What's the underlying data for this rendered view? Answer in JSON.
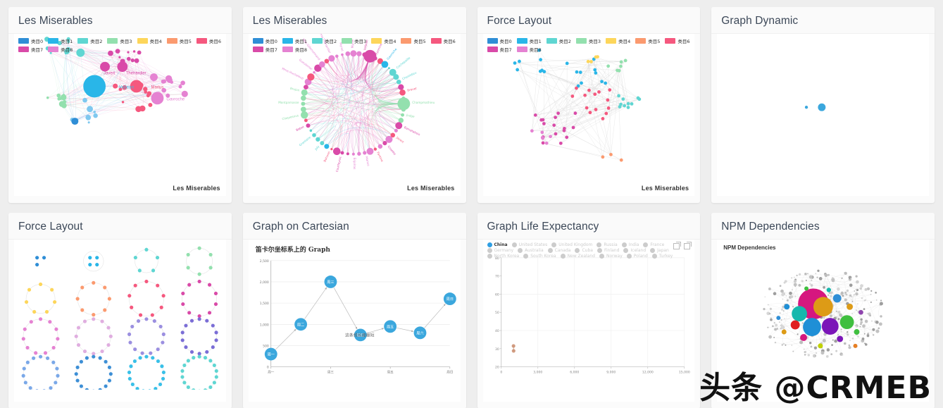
{
  "page": {
    "background": "#eeeeee",
    "watermark": "头条 @CRMEB"
  },
  "cards": [
    {
      "title": "Les Miserables",
      "subtitle": "",
      "footer": "Les Miserables"
    },
    {
      "title": "Les Miserables",
      "subtitle": "",
      "footer": "Les Miserables"
    },
    {
      "title": "Force Layout",
      "subtitle": "",
      "footer": "Les Miserables"
    },
    {
      "title": "Graph Dynamic",
      "subtitle": "",
      "footer": ""
    },
    {
      "title": "Force Layout",
      "subtitle": "",
      "footer": ""
    },
    {
      "title": "Graph on Cartesian",
      "subtitle": "笛卡尔坐标系上的 Graph",
      "footer": ""
    },
    {
      "title": "Graph Life Expectancy",
      "subtitle": "",
      "footer": ""
    },
    {
      "title": "NPM Dependencies",
      "subtitle": "NPM Dependencies",
      "footer": ""
    }
  ],
  "category_legend": {
    "items": [
      {
        "label": "类目0",
        "color": "#2f8ed6"
      },
      {
        "label": "类目1",
        "color": "#29b6e8"
      },
      {
        "label": "类目2",
        "color": "#5fd6d2"
      },
      {
        "label": "类目3",
        "color": "#93e0ae"
      },
      {
        "label": "类目4",
        "color": "#fdd65b"
      },
      {
        "label": "类目5",
        "color": "#fb9a6f"
      },
      {
        "label": "类目6",
        "color": "#f5587e"
      },
      {
        "label": "类目7",
        "color": "#d94aa8"
      },
      {
        "label": "类目8",
        "color": "#e582d2"
      }
    ]
  },
  "chart_data": [
    {
      "type": "scatter",
      "name": "les-miserables-force",
      "title": "Les Miserables",
      "legend_position": "top-left",
      "categories": [
        "类目0",
        "类目1",
        "类目2",
        "类目3",
        "类目4",
        "类目5",
        "类目6",
        "类目7",
        "类目8"
      ],
      "annotations": [
        "Valjean",
        "Marius",
        "Javert",
        "Thenardier",
        "Gavroche"
      ]
    },
    {
      "type": "scatter",
      "name": "les-miserables-circular",
      "title": "Les Miserables",
      "legend_position": "top-left",
      "categories": [
        "类目0",
        "类目1",
        "类目2",
        "类目3",
        "类目4",
        "类目5",
        "类目6",
        "类目7",
        "类目8"
      ],
      "annotations": [
        "Myriel",
        "Valjean",
        "Eponine",
        "Gavroche",
        "Cochepaille",
        "Chenildieu",
        "Brevet",
        "Champmathieu",
        "Judge",
        "Bamatabois",
        "Javert",
        "Cosette",
        "Fantine",
        "Marius",
        "Enjolras",
        "Courfeyrac",
        "Bahorel",
        "Joly",
        "Grantaire",
        "Babet",
        "Claquesous",
        "Montparnasse",
        "Brujon",
        "Mme.Hucheloup",
        "Gueulemer",
        "Mlle.Gillenormand",
        "Mme.Thenardier"
      ]
    },
    {
      "type": "scatter",
      "name": "force-layout-les-mis",
      "title": "Les Miserables",
      "legend_position": "top-left",
      "categories": [
        "类目0",
        "类目1",
        "类目2",
        "类目3",
        "类目4",
        "类目5",
        "类目6",
        "类目7",
        "类目8"
      ]
    },
    {
      "type": "scatter",
      "name": "graph-dynamic",
      "title": "",
      "nodes": 2
    },
    {
      "type": "scatter",
      "name": "force-layout-rings",
      "title": "",
      "grid_rows": 4,
      "grid_cols": 4,
      "ring_node_counts": [
        3,
        4,
        5,
        6,
        7,
        8,
        9,
        10,
        11,
        12,
        13,
        14,
        15,
        16,
        17,
        18
      ],
      "ring_colors": [
        "#2f8ed6",
        "#29b6e8",
        "#5fd6d2",
        "#93e0ae",
        "#fdd65b",
        "#fb9a6f",
        "#f5587e",
        "#d94aa8",
        "#e582d2",
        "#e0aee0",
        "#9b8fe0",
        "#7b6ed6",
        "#7aa8e8",
        "#3d8fd6",
        "#39c0e8",
        "#5fd6d2"
      ]
    },
    {
      "type": "line",
      "name": "graph-on-cartesian",
      "title": "笛卡尔坐标系上的 Graph",
      "xlabel": "",
      "ylabel": "",
      "categories": [
        "周一",
        "周二",
        "周三",
        "周四",
        "周五",
        "周六",
        "周日"
      ],
      "x_tick_labels": [
        "周一",
        "周三",
        "周五",
        "周日"
      ],
      "y_tick_labels": [
        "0",
        "500",
        "1,000",
        "1,500",
        "2,000",
        "2,500"
      ],
      "ylim": [
        0,
        2500
      ],
      "values": [
        300,
        1000,
        2000,
        750,
        950,
        800,
        1600
      ],
      "node_labels": [
        "周一",
        "周二",
        "周三",
        "周四",
        "周五",
        "周六",
        "周日"
      ],
      "annotation": "这条线长度最短",
      "node_color": "#3ba7dd",
      "grid": true
    },
    {
      "type": "scatter",
      "name": "graph-life-expectancy",
      "title": "",
      "xlabel": "",
      "ylabel": "",
      "x_tick_labels": [
        "0",
        "3,000",
        "6,000",
        "9,000",
        "12,000",
        "15,000"
      ],
      "y_tick_labels": [
        "20",
        "30",
        "40",
        "50",
        "60",
        "70",
        "80"
      ],
      "xlim": [
        0,
        15000
      ],
      "ylim": [
        20,
        80
      ],
      "grid": true,
      "legend": [
        {
          "label": "China",
          "selected": true
        },
        {
          "label": "United States",
          "selected": false
        },
        {
          "label": "United Kingdom",
          "selected": false
        },
        {
          "label": "Russia",
          "selected": false
        },
        {
          "label": "India",
          "selected": false
        },
        {
          "label": "France",
          "selected": false
        },
        {
          "label": "Germany",
          "selected": false
        },
        {
          "label": "Australia",
          "selected": false
        },
        {
          "label": "Canada",
          "selected": false
        },
        {
          "label": "Cuba",
          "selected": false
        },
        {
          "label": "Finland",
          "selected": false
        },
        {
          "label": "Iceland",
          "selected": false
        },
        {
          "label": "Japan",
          "selected": false
        },
        {
          "label": "North Korea",
          "selected": false
        },
        {
          "label": "South Korea",
          "selected": false
        },
        {
          "label": "New Zealand",
          "selected": false
        },
        {
          "label": "Norway",
          "selected": false
        },
        {
          "label": "Poland",
          "selected": false
        },
        {
          "label": "Turkey",
          "selected": false
        }
      ],
      "points": [
        {
          "x": 1000,
          "y": 31.5
        },
        {
          "x": 1010,
          "y": 28.8
        }
      ],
      "point_color": "#c98b6b",
      "toolbox": [
        "dataZoom-icon",
        "dataZoom-reset-icon"
      ]
    },
    {
      "type": "scatter",
      "name": "npm-dependencies",
      "title": "NPM Dependencies"
    }
  ]
}
